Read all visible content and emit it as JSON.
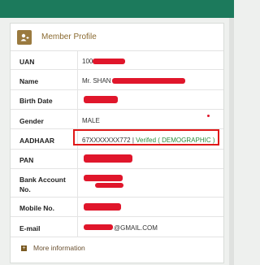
{
  "profile": {
    "title": "Member Profile",
    "header_icon": "user-card-icon",
    "rows": [
      {
        "label": "UAN",
        "value": "100"
      },
      {
        "label": "Name",
        "value": "Mr. SHAN"
      },
      {
        "label": "Birth Date",
        "value": ""
      },
      {
        "label": "Gender",
        "value": "MALE"
      },
      {
        "label": "AADHAAR",
        "value": "67XXXXXXX772 | ",
        "status": "Verifed ( DEMOGRAPHIC )"
      },
      {
        "label": "PAN",
        "value": ""
      },
      {
        "label": "Bank Account No.",
        "value": ""
      },
      {
        "label": "Mobile No.",
        "value": ""
      },
      {
        "label": "E-mail",
        "value": "@GMAIL.COM"
      }
    ],
    "more_info_label": "More information"
  },
  "colors": {
    "top_bar": "#1c7a5c",
    "accent": "#9a7a3f",
    "redaction": "#e0162b",
    "verified": "#2c8a3c"
  }
}
